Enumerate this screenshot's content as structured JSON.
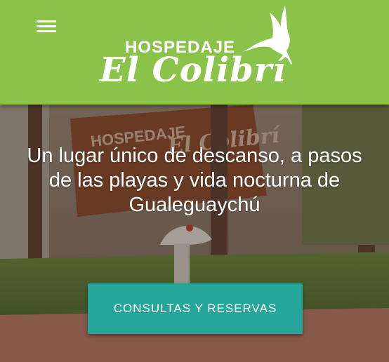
{
  "header": {
    "menu_icon": "hamburger-menu-icon",
    "logo": {
      "top_text": "HOSPEDAJE",
      "main_text": "El Colibrí",
      "icon": "hummingbird-icon"
    },
    "background_color": "#8bc34a"
  },
  "hero": {
    "background_description_icon": "hospedaje-sign-photo",
    "sign_text_top": "HOSPEDAJE",
    "sign_text_main": "El Colibrí",
    "tagline_lines": [
      "Un lugar único de descanso, a pasos",
      "de las playas y vida nocturna de",
      "Gualeguaychú"
    ],
    "cta_label": "CONSULTAS Y RESERVAS",
    "cta_color": "#26a69a"
  }
}
